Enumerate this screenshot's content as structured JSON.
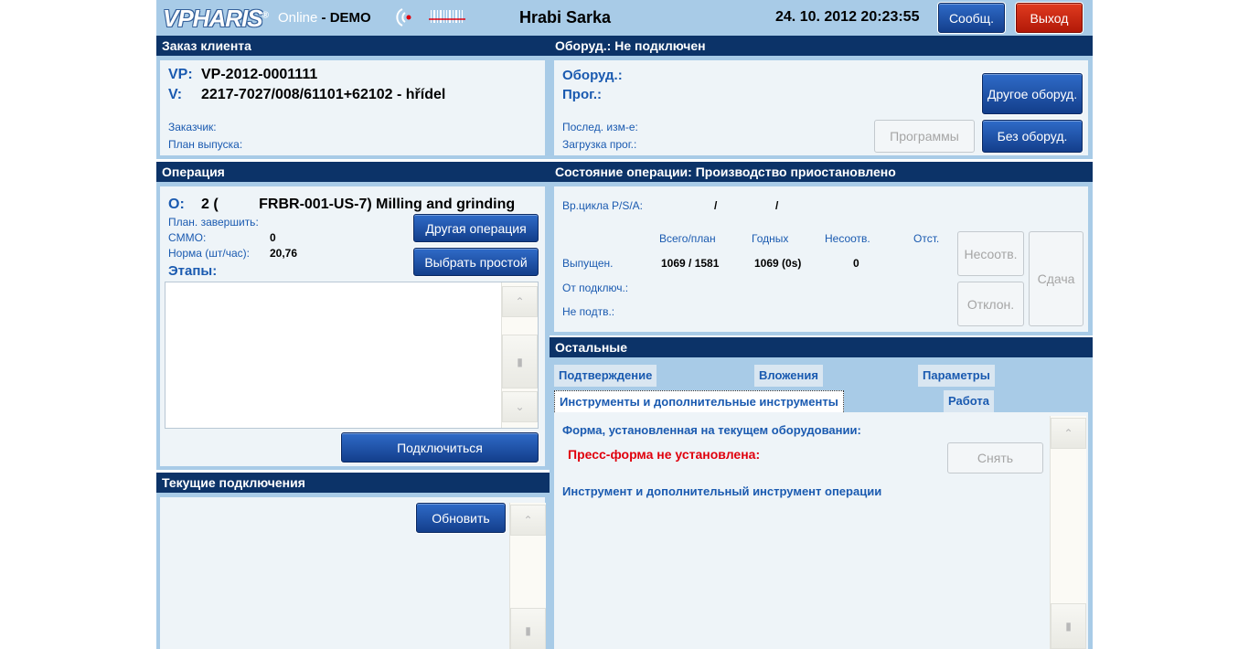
{
  "topbar": {
    "logo": "VPHARIS",
    "logo_mark": "®",
    "online": "Online",
    "mode": "- DEMO",
    "user": "Hrabi Sarka",
    "datetime": "24. 10. 2012 20:23:55",
    "messages_label": "Сообщ.",
    "exit_label": "Выход"
  },
  "order": {
    "header": "Заказ клиента",
    "vp_label": "VP:",
    "vp_value": "VP-2012-0001111",
    "v_label": "V:",
    "v_value": "2217-7027/008/61101+62102 - hřídel",
    "customer_label": "Заказчик:",
    "plan_label": "План выпуска:"
  },
  "equipment": {
    "header": "Оборуд.: Не подключен",
    "equip_label": "Оборуд.:",
    "prog_label": "Прог.:",
    "last_change_label": "Послед. изм-е:",
    "prog_load_label": "Загрузка прог.:",
    "other_equip_label": "Другое оборуд.",
    "programs_label": "Программы",
    "no_equip_label": "Без оборуд."
  },
  "operation": {
    "header": "Операция",
    "o_label": "O:",
    "o_value": "2 (          FRBR-001-US-7) Milling and grinding",
    "plan_finish_label": "План. завершить:",
    "cmmo_label": "CMMO:",
    "cmmo_value": "0",
    "norm_label": "Норма (шт/час):",
    "norm_value": "20,76",
    "stages_label": "Этапы:",
    "other_op_label": "Другая операция",
    "choose_idle_label": "Выбрать простой",
    "connect_label": "Подключиться"
  },
  "state": {
    "header": "Состояние операции: Производство приостановлено",
    "cycle_label": "Вр.цикла P/S/A:",
    "cycle_sep1": "/",
    "cycle_sep2": "/",
    "col_total": "Всего/план",
    "col_good": "Годных",
    "col_noncomp": "Несоотв.",
    "col_rej": "Отст.",
    "row_released": "Выпущен.",
    "row_from_conn": "От подключ.:",
    "row_unconfirmed": "Не подтв.:",
    "released_total": "1069 / 1581",
    "released_good": "1069 (0s)",
    "released_noncomp": "0",
    "btn_noncomp": "Несоотв.",
    "btn_reject": "Отклон.",
    "btn_handover": "Сдача"
  },
  "connections": {
    "header": "Текущие подключения",
    "refresh_label": "Обновить"
  },
  "others": {
    "header": "Остальные",
    "tabs": {
      "confirm": "Подтверждение",
      "attachments": "Вложения",
      "params": "Параметры",
      "tools": "Инструменты и дополнительные инструменты",
      "work": "Работа"
    },
    "mold_label": "Форма, установленная на текущем оборудовании:",
    "mold_missing": "Пресс-форма не установлена:",
    "remove_label": "Снять",
    "tool_label": "Инструмент и дополнительный инструмент операции"
  },
  "icons": {
    "rfid": "rfid-signal-icon",
    "barcode": "barcode-icon",
    "scroll_up": "chevron-up-icon",
    "scroll_down": "chevron-down-icon",
    "scroll_thumb": "scroll-thumb-icon"
  },
  "colors": {
    "header_bg": "#0c3368",
    "frame_bg": "#a8cbe7",
    "panel_bg": "#eef4f8",
    "label_blue": "#1a5ab0",
    "exit_red": "#c9220f",
    "warning_red": "#e0000d"
  }
}
